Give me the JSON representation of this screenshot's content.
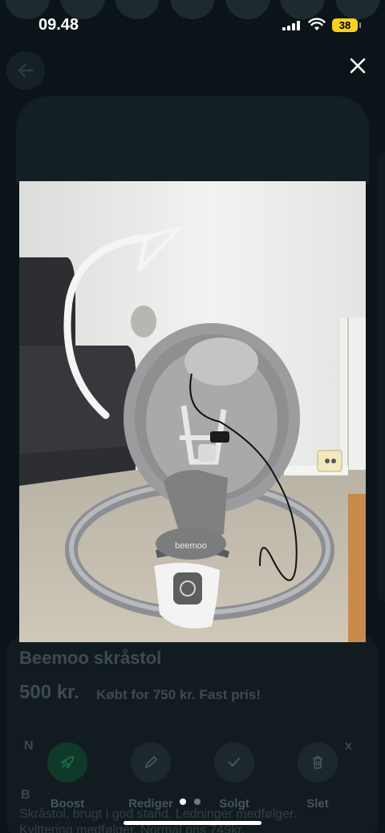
{
  "status_bar": {
    "time": "09.48",
    "battery": "38"
  },
  "listing": {
    "title": "Beemoo skråstol",
    "price": "500 kr.",
    "meta": "Købt for 750 kr.  Fast pris!",
    "row_start": "N",
    "row_end": "x",
    "desc_label": "B",
    "description_1": "Skråstol, brugt i god stand. Ledninger medfølger.",
    "description_2": "Kvittering medfølger. Normal pris 749kr."
  },
  "photo": {
    "brand_text": "beemoo"
  },
  "actions": [
    {
      "label": "Boost",
      "icon": "rocket-icon"
    },
    {
      "label": "Rediger",
      "icon": "pencil-icon"
    },
    {
      "label": "Solgt",
      "icon": "check-icon"
    },
    {
      "label": "Slet",
      "icon": "trash-icon"
    }
  ],
  "pager": {
    "count": 2,
    "active": 1
  },
  "colors": {
    "background": "#0b1418",
    "battery": "#f5d020",
    "boost": "#0f3a2a"
  }
}
